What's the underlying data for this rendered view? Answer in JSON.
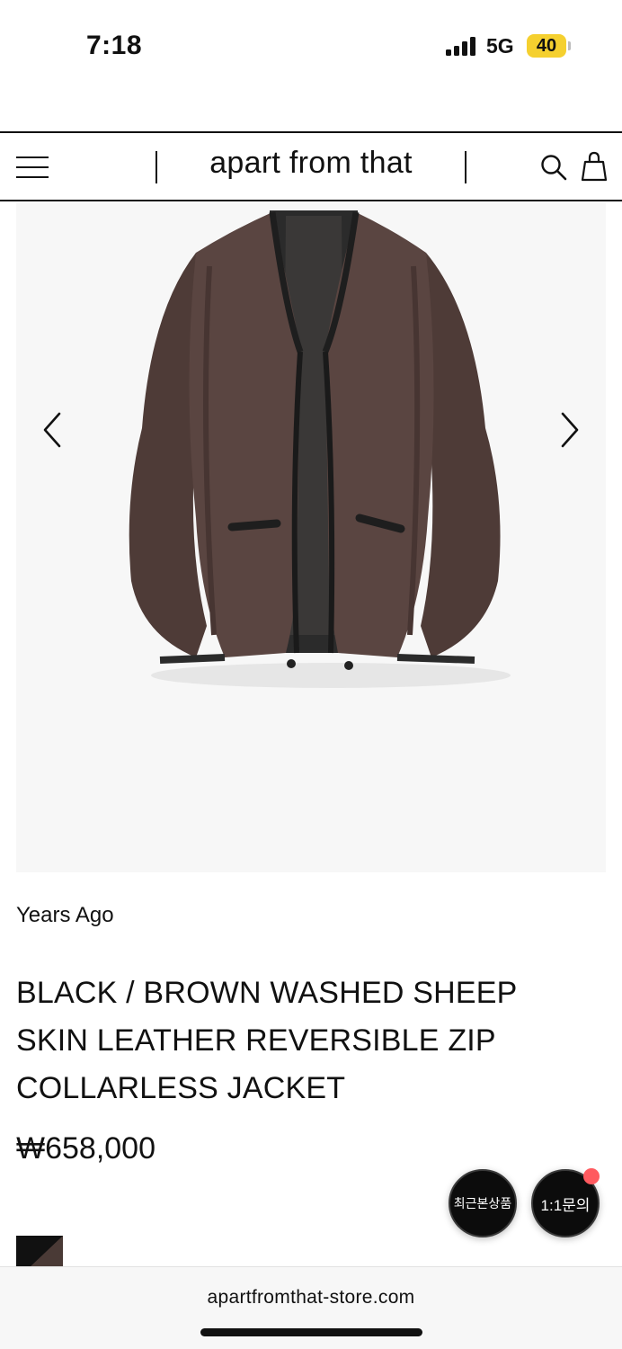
{
  "status_bar": {
    "time": "7:18",
    "network": "5G",
    "battery": "40",
    "battery_color": "#f5d02f"
  },
  "header": {
    "brand": "apart from that",
    "icons": [
      "menu-icon",
      "search-icon",
      "shopping-bag-icon"
    ]
  },
  "gallery": {
    "image_subject": "brown reversible collarless zip jacket",
    "icons": [
      "chevron-left-icon",
      "chevron-right-icon"
    ]
  },
  "product": {
    "vendor": "Years Ago",
    "title": "BLACK / BROWN WASHED SHEEP SKIN LEATHER REVERSIBLE ZIP COLLARLESS JACKET",
    "price": "₩658,000",
    "swatch_colors": [
      "#111111",
      "#4a3a36"
    ]
  },
  "floating": {
    "recent_label": "최근본상품",
    "inquiry_label": "1:1문의",
    "notification_color": "#ff5a5f"
  },
  "browser": {
    "url": "apartfromthat-store.com"
  }
}
